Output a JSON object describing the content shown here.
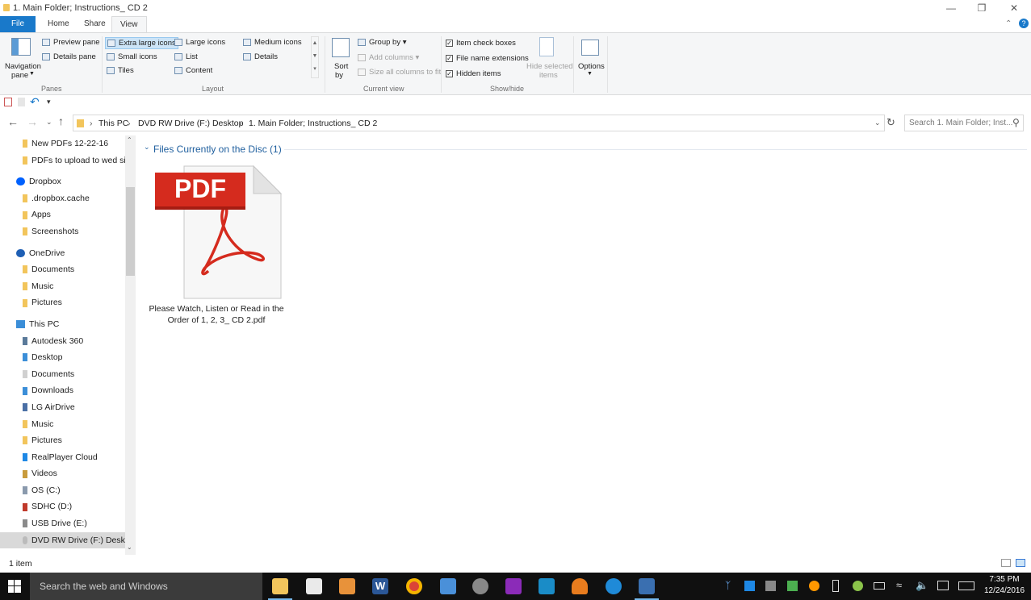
{
  "window": {
    "title": "1. Main Folder; Instructions_ CD 2"
  },
  "tabs": [
    "File",
    "Home",
    "Share",
    "View"
  ],
  "ribbon": {
    "panes": {
      "navigation_pane": "Navigation",
      "navigation_pane2": "pane",
      "preview_pane": "Preview pane",
      "details_pane": "Details pane",
      "group_label": "Panes"
    },
    "layout": {
      "items": [
        "Extra large icons",
        "Large icons",
        "Medium icons",
        "Small icons",
        "List",
        "Details",
        "Tiles",
        "Content"
      ],
      "selected": "Extra large icons",
      "group_label": "Layout"
    },
    "current_view": {
      "sort": "Sort",
      "sort2": "by",
      "group_by": "Group by",
      "add_columns": "Add columns",
      "size_columns": "Size all columns to fit",
      "group_label": "Current view"
    },
    "show_hide": {
      "item_check_boxes": "Item check boxes",
      "file_name_extensions": "File name extensions",
      "hidden_items": "Hidden items",
      "hide_selected": "Hide selected",
      "hide_selected2": "items",
      "group_label": "Show/hide"
    },
    "options": "Options"
  },
  "breadcrumb": [
    "This PC",
    "DVD RW Drive (F:) Desktop",
    "1. Main Folder; Instructions_ CD 2"
  ],
  "search": {
    "placeholder": "Search 1. Main Folder; Inst..."
  },
  "nav_pane": [
    {
      "label": "New PDFs 12-22-16",
      "icon": "folder-icon",
      "indent": 1
    },
    {
      "label": "PDFs to upload to wed si",
      "icon": "folder-icon",
      "indent": 1
    },
    {
      "label": "Dropbox",
      "icon": "dropbox-icon",
      "indent": 0
    },
    {
      "label": ".dropbox.cache",
      "icon": "folder-icon",
      "indent": 1
    },
    {
      "label": "Apps",
      "icon": "folder-icon",
      "indent": 1
    },
    {
      "label": "Screenshots",
      "icon": "folder-icon",
      "indent": 1
    },
    {
      "label": "OneDrive",
      "icon": "onedrive-icon",
      "indent": 0
    },
    {
      "label": "Documents",
      "icon": "folder-icon",
      "indent": 1
    },
    {
      "label": "Music",
      "icon": "folder-icon",
      "indent": 1
    },
    {
      "label": "Pictures",
      "icon": "folder-icon",
      "indent": 1
    },
    {
      "label": "This PC",
      "icon": "pc-icon",
      "indent": 0
    },
    {
      "label": "Autodesk 360",
      "icon": "autodesk-icon",
      "indent": 1
    },
    {
      "label": "Desktop",
      "icon": "desktop-folder-icon",
      "indent": 1
    },
    {
      "label": "Documents",
      "icon": "documents-folder-icon",
      "indent": 1
    },
    {
      "label": "Downloads",
      "icon": "downloads-folder-icon",
      "indent": 1
    },
    {
      "label": "LG AirDrive",
      "icon": "airdrive-icon",
      "indent": 1
    },
    {
      "label": "Music",
      "icon": "music-folder-icon",
      "indent": 1
    },
    {
      "label": "Pictures",
      "icon": "pictures-folder-icon",
      "indent": 1
    },
    {
      "label": "RealPlayer Cloud",
      "icon": "realplayer-icon",
      "indent": 1
    },
    {
      "label": "Videos",
      "icon": "videos-folder-icon",
      "indent": 1
    },
    {
      "label": "OS (C:)",
      "icon": "drive-icon",
      "indent": 1
    },
    {
      "label": "SDHC (D:)",
      "icon": "sd-card-icon",
      "indent": 1
    },
    {
      "label": "USB Drive (E:)",
      "icon": "usb-drive-icon",
      "indent": 1
    },
    {
      "label": "DVD RW Drive (F:) Deskto",
      "icon": "dvd-drive-icon",
      "indent": 1,
      "selected": true
    }
  ],
  "content": {
    "group_header": "Files Currently on the Disc (1)",
    "file": {
      "label_line1": "Please Watch, Listen or Read in the",
      "label_line2": "Order of 1, 2, 3_ CD 2.pdf",
      "badge": "PDF"
    }
  },
  "status": {
    "count": "1 item"
  },
  "taskbar": {
    "search_placeholder": "Search the web and Windows",
    "time": "7:35 PM",
    "date": "12/24/2016"
  },
  "colors": {
    "accent": "#1979ca",
    "pdf_red": "#d52b1e",
    "selection": "#cce4f7"
  }
}
